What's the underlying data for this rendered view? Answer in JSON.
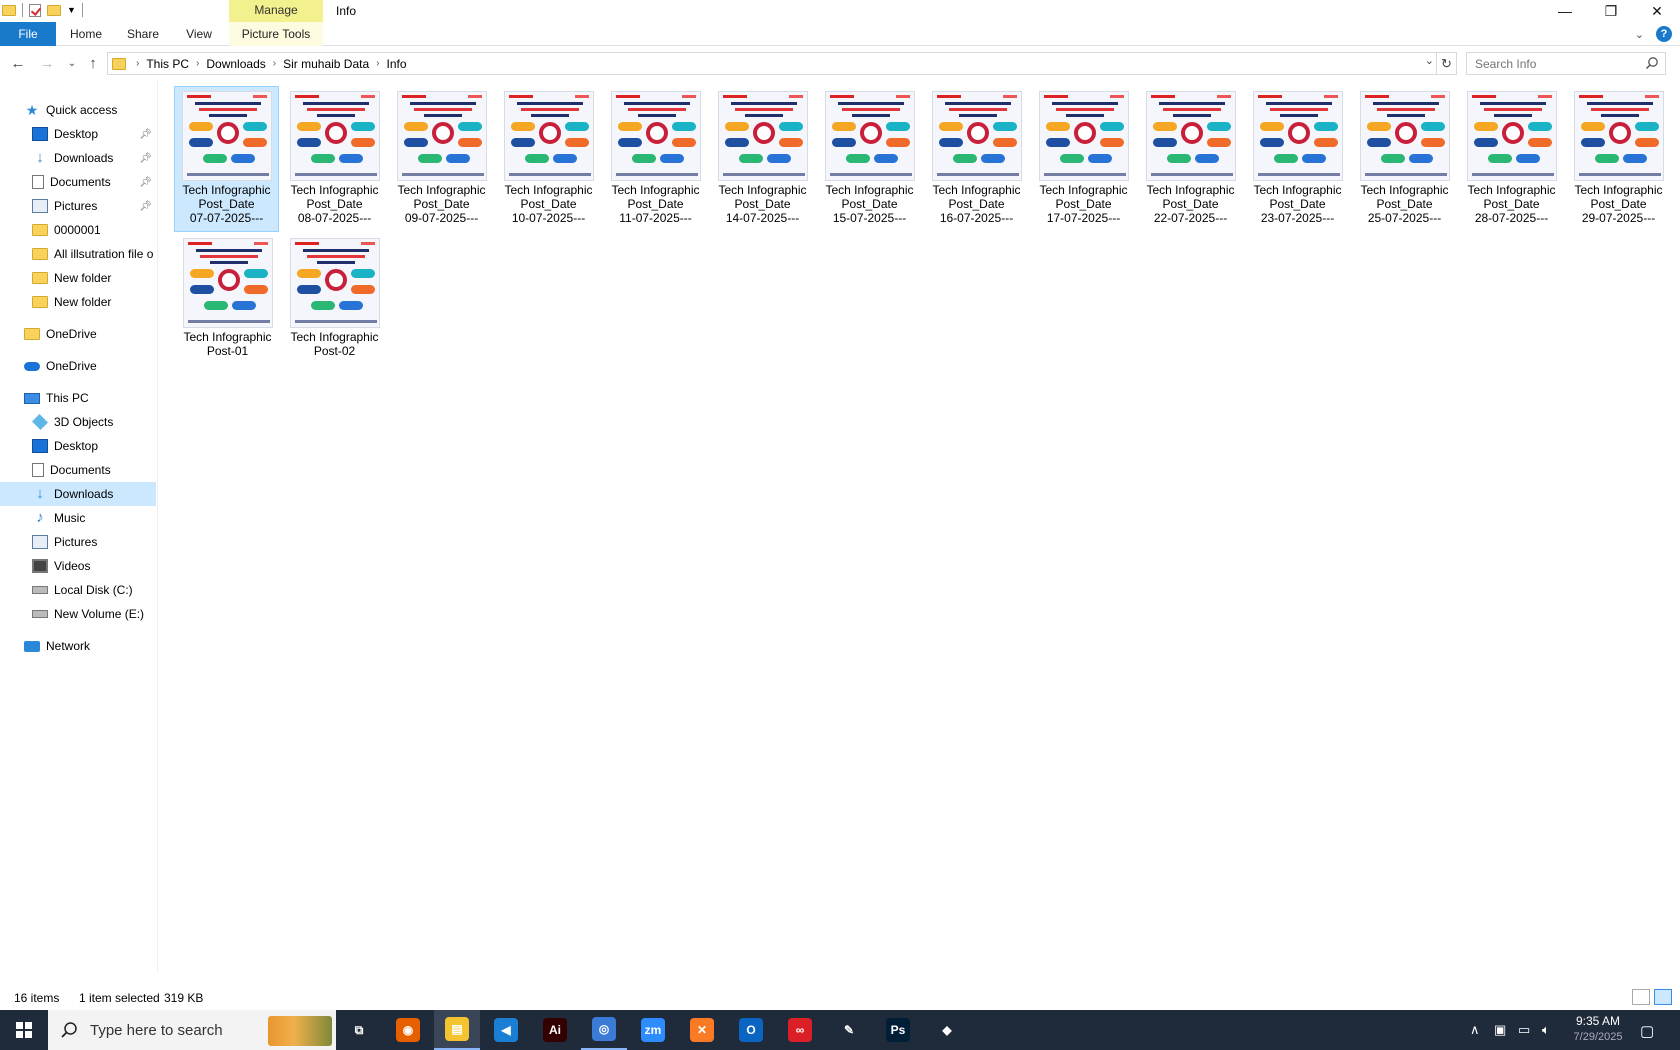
{
  "window": {
    "title": "Info",
    "manage_label": "Manage",
    "minimize": "—",
    "restore": "❐",
    "close": "✕"
  },
  "ribbon": {
    "tabs": [
      "File",
      "Home",
      "Share",
      "View",
      "Picture Tools"
    ]
  },
  "address": {
    "crumbs": [
      "This PC",
      "Downloads",
      "Sir muhaib Data",
      "Info"
    ],
    "search_placeholder": "Search Info"
  },
  "sidebar": {
    "quick_access": "Quick access",
    "quick_items": [
      {
        "label": "Desktop",
        "icon": "desktop-icon",
        "pinned": true
      },
      {
        "label": "Downloads",
        "icon": "download-icon",
        "pinned": true
      },
      {
        "label": "Documents",
        "icon": "document-icon",
        "pinned": true
      },
      {
        "label": "Pictures",
        "icon": "pictures-icon",
        "pinned": true
      },
      {
        "label": "0000001",
        "icon": "folder-icon",
        "pinned": false
      },
      {
        "label": "All illsutration file o",
        "icon": "folder-icon",
        "pinned": false
      },
      {
        "label": "New folder",
        "icon": "folder-icon",
        "pinned": false
      },
      {
        "label": "New folder",
        "icon": "folder-icon",
        "pinned": false
      }
    ],
    "onedrive1": "OneDrive",
    "onedrive2": "OneDrive",
    "this_pc": "This PC",
    "pc_items": [
      {
        "label": "3D Objects",
        "icon": "3d-objects-icon"
      },
      {
        "label": "Desktop",
        "icon": "desktop-icon"
      },
      {
        "label": "Documents",
        "icon": "document-icon"
      },
      {
        "label": "Downloads",
        "icon": "download-icon",
        "selected": true
      },
      {
        "label": "Music",
        "icon": "music-icon"
      },
      {
        "label": "Pictures",
        "icon": "pictures-icon"
      },
      {
        "label": "Videos",
        "icon": "video-icon"
      },
      {
        "label": "Local Disk (C:)",
        "icon": "drive-icon"
      },
      {
        "label": "New Volume (E:)",
        "icon": "drive-icon"
      }
    ],
    "network": "Network"
  },
  "files": [
    {
      "line1": "Tech Infographic",
      "line2": "Post_Date",
      "line3": "07-07-2025---",
      "selected": true
    },
    {
      "line1": "Tech Infographic",
      "line2": "Post_Date",
      "line3": "08-07-2025---"
    },
    {
      "line1": "Tech Infographic",
      "line2": "Post_Date",
      "line3": "09-07-2025---"
    },
    {
      "line1": "Tech Infographic",
      "line2": "Post_Date",
      "line3": "10-07-2025---"
    },
    {
      "line1": "Tech Infographic",
      "line2": "Post_Date",
      "line3": "11-07-2025---"
    },
    {
      "line1": "Tech Infographic",
      "line2": "Post_Date",
      "line3": "14-07-2025---"
    },
    {
      "line1": "Tech Infographic",
      "line2": "Post_Date",
      "line3": "15-07-2025---"
    },
    {
      "line1": "Tech Infographic",
      "line2": "Post_Date",
      "line3": "16-07-2025---"
    },
    {
      "line1": "Tech Infographic",
      "line2": "Post_Date",
      "line3": "17-07-2025---"
    },
    {
      "line1": "Tech Infographic",
      "line2": "Post_Date",
      "line3": "22-07-2025---"
    },
    {
      "line1": "Tech Infographic",
      "line2": "Post_Date",
      "line3": "23-07-2025---"
    },
    {
      "line1": "Tech Infographic",
      "line2": "Post_Date",
      "line3": "25-07-2025---"
    },
    {
      "line1": "Tech Infographic",
      "line2": "Post_Date",
      "line3": "28-07-2025---"
    },
    {
      "line1": "Tech Infographic",
      "line2": "Post_Date",
      "line3": "29-07-2025---"
    },
    {
      "line1": "Tech Infographic",
      "line2": "Post-01",
      "line3": ""
    },
    {
      "line1": "Tech Infographic",
      "line2": "Post-02",
      "line3": ""
    }
  ],
  "status": {
    "count": "16 items",
    "selected": "1 item selected",
    "size": "319 KB"
  },
  "taskbar": {
    "search_text": "Type here to search",
    "apps": [
      {
        "name": "task-view",
        "label": "⧉",
        "color": "#1f2a3a"
      },
      {
        "name": "firefox",
        "label": "◉",
        "color": "#e66000"
      },
      {
        "name": "file-explorer",
        "label": "▤",
        "color": "#f4c430",
        "active": true
      },
      {
        "name": "vscode",
        "label": "◀",
        "color": "#1a7fd4"
      },
      {
        "name": "illustrator",
        "label": "Ai",
        "color": "#330000"
      },
      {
        "name": "chrome",
        "label": "◎",
        "color": "#3a7bd5",
        "open": true
      },
      {
        "name": "zoom",
        "label": "zm",
        "color": "#2d8cff"
      },
      {
        "name": "xampp",
        "label": "✕",
        "color": "#fb7a24"
      },
      {
        "name": "outlook",
        "label": "O",
        "color": "#0a64c2"
      },
      {
        "name": "creative-cloud",
        "label": "∞",
        "color": "#da1f26"
      },
      {
        "name": "pen-tool",
        "label": "✎",
        "color": "#1f2a3a"
      },
      {
        "name": "photoshop",
        "label": "Ps",
        "color": "#001e36"
      },
      {
        "name": "app-gem",
        "label": "◆",
        "color": "#1f2a3a"
      }
    ],
    "time": "9:35 AM",
    "date": "7/29/2025",
    "tray_arrow": "∧"
  }
}
